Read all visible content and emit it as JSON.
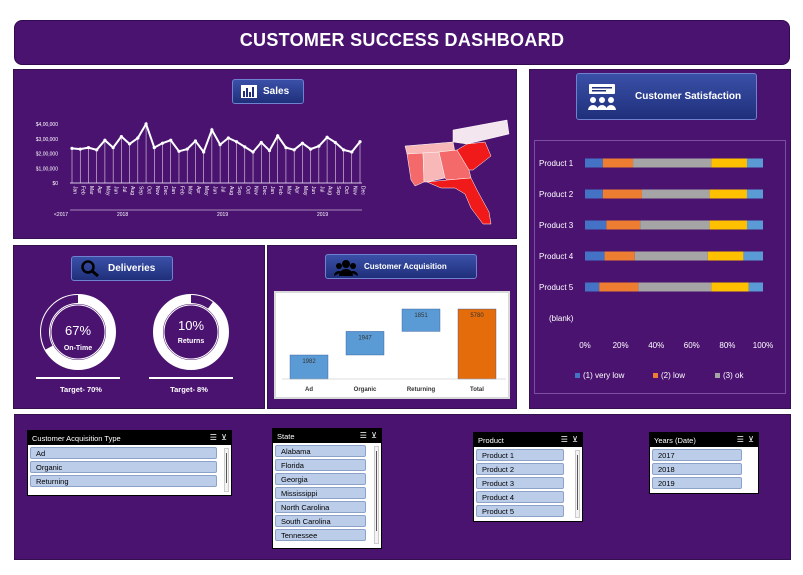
{
  "dashboard": {
    "title": "CUSTOMER SUCCESS DASHBOARD"
  },
  "sales": {
    "button_label": "Sales",
    "y_ticks": [
      "$4,00,000",
      "$3,00,000",
      "$2,00,000",
      "$1,00,000",
      "$0"
    ],
    "month_labels": [
      "Jan",
      "Feb",
      "Mar",
      "Apr",
      "May",
      "Jun",
      "Jul",
      "Aug",
      "Sep",
      "Oct",
      "Nov",
      "Dec",
      "Jan",
      "Feb",
      "Mar",
      "Apr",
      "May",
      "Jun",
      "Jul",
      "Aug",
      "Sep",
      "Oct",
      "Nov",
      "Dec",
      "Jan",
      "Feb",
      "Mar",
      "Apr",
      "May",
      "Jun",
      "Jul",
      "Aug",
      "Sep",
      "Oct",
      "Nov",
      "Dec"
    ],
    "year_labels": [
      "<2017",
      "2018",
      "2019",
      "2019"
    ],
    "map_states": [
      "Alabama",
      "Florida",
      "Georgia",
      "Mississippi",
      "North Carolina",
      "South Carolina",
      "Tennessee"
    ],
    "colors": {
      "line": "#ffffff",
      "map_dark": "#f01a1a",
      "map_mid": "#f46a6a",
      "map_light": "#f8b8b8"
    }
  },
  "satisfaction": {
    "button_label": "Customer Satisfaction",
    "x_ticks": [
      "0%",
      "20%",
      "40%",
      "60%",
      "80%",
      "100%"
    ],
    "blank_label": "(blank)",
    "legend": [
      {
        "label": "(1) very low",
        "color": "#4472c4"
      },
      {
        "label": "(2) low",
        "color": "#ed7d31"
      },
      {
        "label": "(3) ok",
        "color": "#a5a5a5"
      }
    ]
  },
  "deliveries": {
    "button_label": "Deliveries",
    "on_time_pct": "67%",
    "on_time_label": "On-Time",
    "on_time_value": 0.67,
    "on_time_target": "Target- 70%",
    "returns_pct": "10%",
    "returns_label": "Returns",
    "returns_value": 0.1,
    "returns_target": "Target- 8%"
  },
  "acquisition": {
    "button_label": "Customer Acquisition",
    "colors": {
      "bar": "#5b9bd5",
      "total": "#e46c0a"
    }
  },
  "slicers": {
    "acq_type": {
      "title": "Customer Acquisition Type",
      "items": [
        "Ad",
        "Organic",
        "Returning"
      ]
    },
    "state": {
      "title": "State",
      "items": [
        "Alabama",
        "Florida",
        "Georgia",
        "Mississippi",
        "North Carolina",
        "South Carolina",
        "Tennessee"
      ]
    },
    "product": {
      "title": "Product",
      "items": [
        "Product 1",
        "Product 2",
        "Product 3",
        "Product 4",
        "Product 5"
      ]
    },
    "years": {
      "title": "Years (Date)",
      "items": [
        "2017",
        "2018",
        "2019"
      ]
    }
  },
  "chart_data": [
    {
      "type": "line",
      "title": "",
      "x": [
        "Jan",
        "Feb",
        "Mar",
        "Apr",
        "May",
        "Jun",
        "Jul",
        "Aug",
        "Sep",
        "Oct",
        "Nov",
        "Dec",
        "Jan",
        "Feb",
        "Mar",
        "Apr",
        "May",
        "Jun",
        "Jul",
        "Aug",
        "Sep",
        "Oct",
        "Nov",
        "Dec",
        "Jan",
        "Feb",
        "Mar",
        "Apr",
        "May",
        "Jun",
        "Jul",
        "Aug",
        "Sep",
        "Oct",
        "Nov",
        "Dec"
      ],
      "values": [
        235000,
        230000,
        240000,
        225000,
        290000,
        240000,
        315000,
        265000,
        305000,
        400000,
        240000,
        270000,
        290000,
        215000,
        230000,
        285000,
        210000,
        360000,
        260000,
        305000,
        280000,
        245000,
        210000,
        275000,
        220000,
        320000,
        240000,
        225000,
        270000,
        230000,
        250000,
        310000,
        275000,
        225000,
        210000,
        280000
      ],
      "ylim": [
        0,
        400000
      ],
      "grid": false
    },
    {
      "type": "bar",
      "orientation": "horizontal-stacked-100",
      "categories": [
        "Product 1",
        "Product 2",
        "Product 3",
        "Product 4",
        "Product 5"
      ],
      "series": [
        {
          "name": "(1) very low",
          "values": [
            10,
            10,
            12,
            11,
            8
          ]
        },
        {
          "name": "(2) low",
          "values": [
            17,
            22,
            19,
            17,
            22
          ]
        },
        {
          "name": "(3) ok",
          "values": [
            44,
            38,
            39,
            41,
            41
          ]
        },
        {
          "name": "",
          "values": [
            20,
            21,
            21,
            20,
            21
          ]
        },
        {
          "name": "",
          "values": [
            9,
            9,
            9,
            11,
            8
          ]
        }
      ],
      "series_colors": [
        "#4472c4",
        "#ed7d31",
        "#a5a5a5",
        "#ffc000",
        "#5b9bd5"
      ],
      "xlim": [
        0,
        100
      ]
    },
    {
      "type": "bar",
      "subtype": "waterfall",
      "categories": [
        "Ad",
        "Organic",
        "Returning",
        "Total"
      ],
      "values": [
        1982,
        1947,
        1851,
        5780
      ]
    }
  ]
}
